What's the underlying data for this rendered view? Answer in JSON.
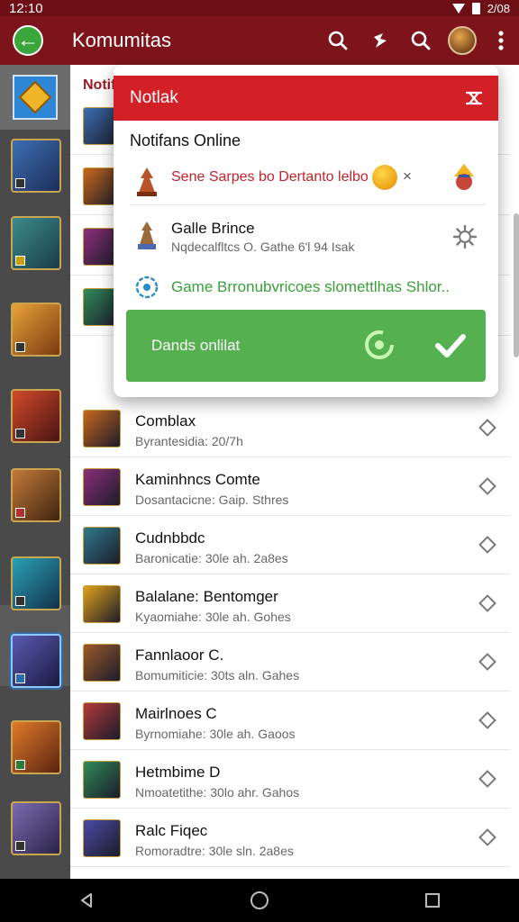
{
  "status_bar": {
    "time": "12:10",
    "right_text": "2/08"
  },
  "app_bar": {
    "title": "Komumitas"
  },
  "list": {
    "header": "Notif",
    "rows": [
      {
        "title": "Comblax",
        "subtitle": "Byrantesidia: 20/7h",
        "thumb_color": "#c7681c"
      },
      {
        "title": "Kaminhncs Comte",
        "subtitle": "Dosantacicne: Gaip. Sthres",
        "thumb_color": "#8b2f7a"
      },
      {
        "title": "Cudnbbdc",
        "subtitle": "Baronicatie: 30le ah. 2a8es",
        "thumb_color": "#2f7a8b"
      },
      {
        "title": "Balalane: Bentomger",
        "subtitle": "Kyaomiahe: 30le ah. Gohes",
        "thumb_color": "#e0a21c"
      },
      {
        "title": "Fannlaoor C.",
        "subtitle": "Bomumiticie: 30ts aln. Gahes",
        "thumb_color": "#9a5a2a"
      },
      {
        "title": "Mairlnoes C",
        "subtitle": "Byrnomiahe: 30le ah. Gaoos",
        "thumb_color": "#b23a3a"
      },
      {
        "title": "Hetmbime D",
        "subtitle": "Nmoatetithe: 30lo ahr. Gahos",
        "thumb_color": "#2f8b5a"
      },
      {
        "title": "Ralc Fiqec",
        "subtitle": "Romoradtre: 30le sln. 2a8es",
        "thumb_color": "#4a4aa6"
      }
    ]
  },
  "popup": {
    "header": "Notlak",
    "subtitle": "Notifans Online",
    "item1_text": "Sene Sarpes bo Dertanto lelbo",
    "item1_close": "×",
    "item2_title": "Galle Brince",
    "item2_subtitle": "Nqdecalfltcs O. Gathe 6'l 94 Isak",
    "item3_text": "Game Brronubvricoes slomettlhas Shlor..",
    "button_label": "Dands onlilat"
  },
  "colors": {
    "appbar": "#7e141b",
    "popup_header": "#d32027",
    "success_green": "#55b04f",
    "link_green": "#3aa03a"
  },
  "icons": [
    "back-arrow-icon",
    "search-icon",
    "share-icon",
    "search-icon",
    "user-avatar-icon",
    "more-vert-icon",
    "close-icon",
    "gear-icon",
    "shield-icon",
    "refresh-icon",
    "check-icon"
  ]
}
